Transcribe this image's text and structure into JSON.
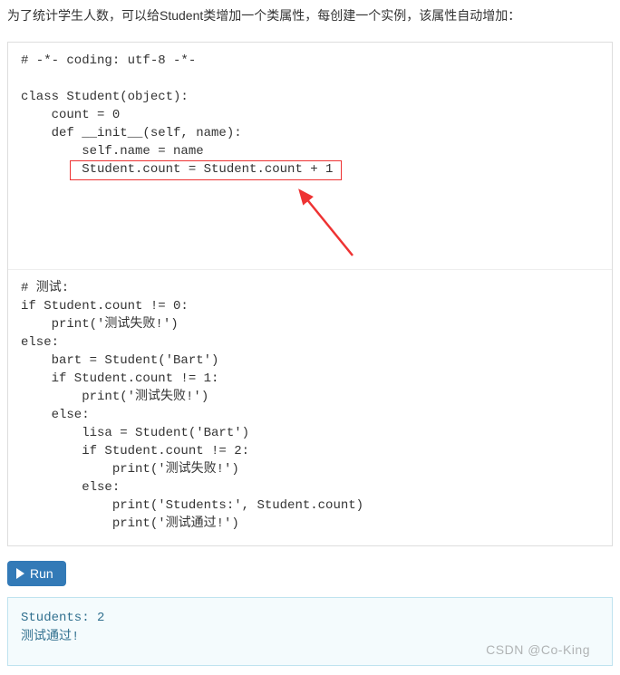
{
  "intro": "为了统计学生人数，可以给Student类增加一个类属性，每创建一个实例，该属性自动增加：",
  "code": {
    "part1": "# -*- coding: utf-8 -*-\n\nclass Student(object):\n    count = 0\n    def __init__(self, name):\n        self.name = name\n        Student.count = Student.count + 1",
    "highlighted_line": "Student.count = Student.count + 1",
    "part2": "# 测试:\nif Student.count != 0:\n    print('测试失败!')\nelse:\n    bart = Student('Bart')\n    if Student.count != 1:\n        print('测试失败!')\n    else:\n        lisa = Student('Bart')\n        if Student.count != 2:\n            print('测试失败!')\n        else:\n            print('Students:', Student.count)\n            print('测试通过!')"
  },
  "run": {
    "label": "Run"
  },
  "output": {
    "line1": "Students: 2",
    "line2": "测试通过!"
  },
  "watermark": "CSDN @Co-King"
}
